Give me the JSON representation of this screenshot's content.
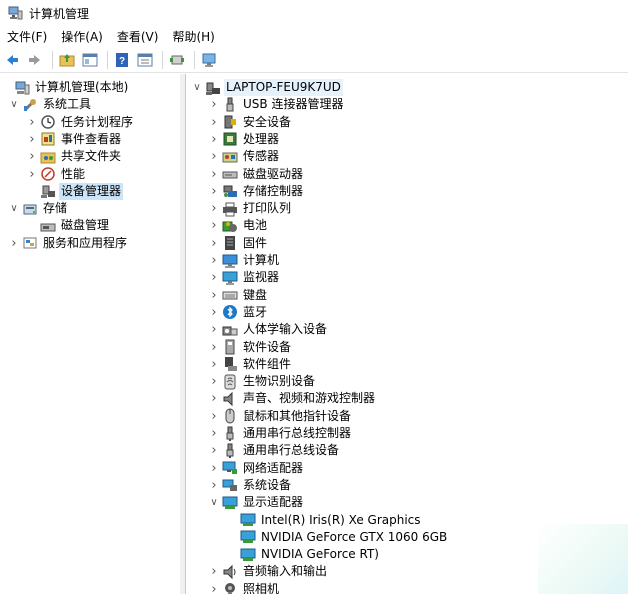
{
  "window": {
    "title": "计算机管理"
  },
  "menu": [
    "文件(F)",
    "操作(A)",
    "查看(V)",
    "帮助(H)"
  ],
  "toolbar": {
    "buttons": [
      "back-icon",
      "forward-icon",
      "up-folder-icon",
      "show-hide-tree-icon",
      "help-icon",
      "properties-icon",
      "update-driver-icon",
      "scan-hardware-icon"
    ]
  },
  "left_tree": [
    {
      "label": "计算机管理(本地)",
      "level": 0,
      "expander": "",
      "icon": "computer-management-icon"
    },
    {
      "label": "系统工具",
      "level": 1,
      "expander": "open",
      "icon": "system-tools-icon"
    },
    {
      "label": "任务计划程序",
      "level": 2,
      "expander": "closed",
      "icon": "task-scheduler-icon"
    },
    {
      "label": "事件查看器",
      "level": 2,
      "expander": "closed",
      "icon": "event-viewer-icon"
    },
    {
      "label": "共享文件夹",
      "level": 2,
      "expander": "closed",
      "icon": "shared-folders-icon"
    },
    {
      "label": "性能",
      "level": 2,
      "expander": "closed",
      "icon": "performance-icon"
    },
    {
      "label": "设备管理器",
      "level": 2,
      "expander": "",
      "icon": "device-manager-icon",
      "selected": true
    },
    {
      "label": "存储",
      "level": 1,
      "expander": "open",
      "icon": "storage-icon"
    },
    {
      "label": "磁盘管理",
      "level": 2,
      "expander": "",
      "icon": "disk-management-icon"
    },
    {
      "label": "服务和应用程序",
      "level": 1,
      "expander": "closed",
      "icon": "services-apps-icon"
    }
  ],
  "device_tree": {
    "root": {
      "label": "LAPTOP-FEU9K7UD",
      "icon": "computer-icon"
    },
    "categories": [
      {
        "label": "USB 连接器管理器",
        "icon": "usb-connector-icon"
      },
      {
        "label": "安全设备",
        "icon": "security-device-icon"
      },
      {
        "label": "处理器",
        "icon": "processor-icon"
      },
      {
        "label": "传感器",
        "icon": "sensor-icon"
      },
      {
        "label": "磁盘驱动器",
        "icon": "disk-drive-icon"
      },
      {
        "label": "存储控制器",
        "icon": "storage-controller-icon"
      },
      {
        "label": "打印队列",
        "icon": "print-queue-icon"
      },
      {
        "label": "电池",
        "icon": "battery-icon"
      },
      {
        "label": "固件",
        "icon": "firmware-icon"
      },
      {
        "label": "计算机",
        "icon": "computer-monitor-icon"
      },
      {
        "label": "监视器",
        "icon": "monitor-icon"
      },
      {
        "label": "键盘",
        "icon": "keyboard-icon"
      },
      {
        "label": "蓝牙",
        "icon": "bluetooth-icon"
      },
      {
        "label": "人体学输入设备",
        "icon": "hid-icon"
      },
      {
        "label": "软件设备",
        "icon": "software-device-icon"
      },
      {
        "label": "软件组件",
        "icon": "software-component-icon"
      },
      {
        "label": "生物识别设备",
        "icon": "biometric-icon"
      },
      {
        "label": "声音、视频和游戏控制器",
        "icon": "sound-icon"
      },
      {
        "label": "鼠标和其他指针设备",
        "icon": "mouse-icon"
      },
      {
        "label": "通用串行总线控制器",
        "icon": "usb-icon"
      },
      {
        "label": "通用串行总线设备",
        "icon": "usb-icon"
      },
      {
        "label": "网络适配器",
        "icon": "network-adapter-icon"
      },
      {
        "label": "系统设备",
        "icon": "system-device-icon"
      },
      {
        "label": "显示适配器",
        "icon": "display-adapter-icon",
        "expanded": true,
        "children": [
          "Intel(R) Iris(R) Xe Graphics",
          "NVIDIA GeForce GTX 1060 6GB",
          "NVIDIA GeForce RT)"
        ]
      },
      {
        "label": "音频输入和输出",
        "icon": "audio-io-icon"
      },
      {
        "label": "照相机",
        "icon": "camera-icon"
      }
    ]
  },
  "colors": {
    "selection": "#cce4f7",
    "root_highlight": "#e5f1fb",
    "accent_blue": "#1e78c8"
  }
}
